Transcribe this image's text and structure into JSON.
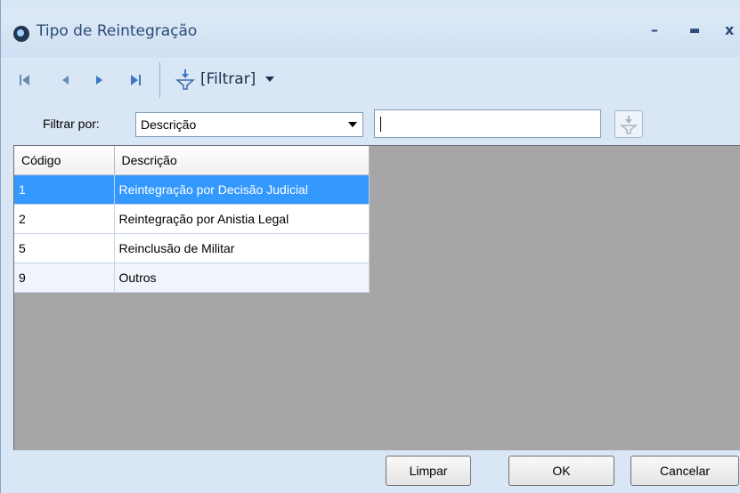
{
  "window": {
    "title": "Tipo de Reintegração",
    "minimize_label": "–",
    "maximize_label": "▬",
    "close_label": "x"
  },
  "toolbar": {
    "filter_menu_label": "[Filtrar]"
  },
  "filter": {
    "label": "Filtrar por:",
    "field_value": "Descrição",
    "search_value": ""
  },
  "grid": {
    "columns": [
      "Código",
      "Descrição"
    ],
    "rows": [
      {
        "code": "1",
        "description": "Reintegração por Decisão Judicial",
        "selected": true
      },
      {
        "code": "2",
        "description": "Reintegração por Anistia Legal",
        "selected": false
      },
      {
        "code": "5",
        "description": "Reinclusão de Militar",
        "selected": false
      },
      {
        "code": "9",
        "description": "Outros",
        "selected": false
      }
    ]
  },
  "buttons": {
    "clear_label": "Limpar",
    "ok_label": "OK",
    "cancel_label": "Cancelar"
  },
  "colors": {
    "selection": "#3399ff",
    "window_background": "#d9e6f5",
    "grid_background": "#a6a6a6"
  }
}
